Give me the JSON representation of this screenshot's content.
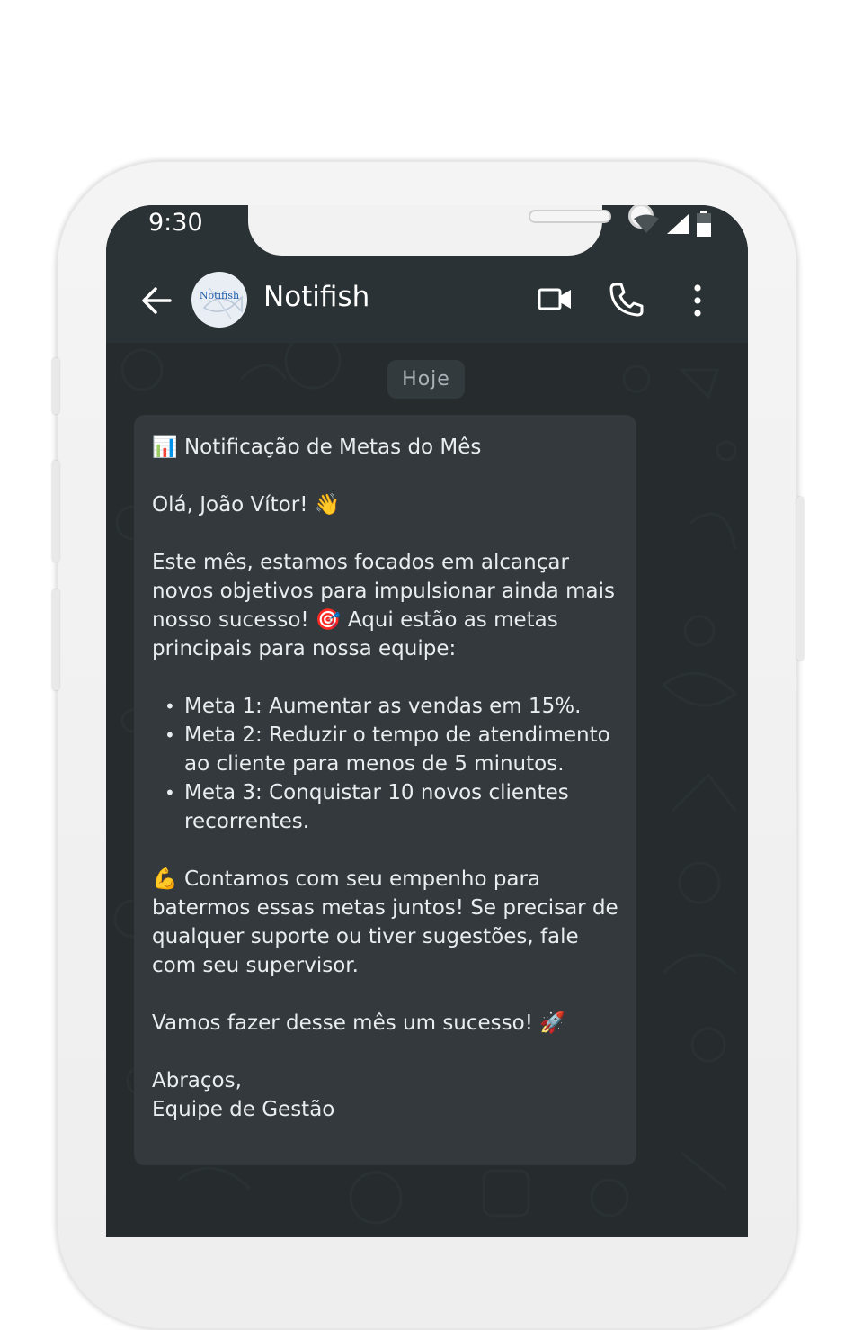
{
  "status_bar": {
    "time": "9:30"
  },
  "header": {
    "contact_name": "Notifish",
    "avatar_text": "Notifish"
  },
  "chat": {
    "date_chip": "Hoje",
    "message": {
      "title": "📊 Notificação de Metas do Mês",
      "greeting": "Olá, João Vítor! 👋",
      "intro": "Este mês, estamos focados em alcançar novos objetivos para impulsionar ainda mais nosso sucesso! 🎯 Aqui estão as metas principais para nossa equipe:",
      "goals": [
        "Meta 1: Aumentar as vendas em 15%.",
        "Meta 2: Reduzir o tempo de atendimento ao cliente para menos de 5 minutos.",
        "Meta 3: Conquistar 10 novos clientes recorrentes."
      ],
      "encouragement": "💪 Contamos com seu empenho para batermos essas metas juntos! Se precisar de qualquer suporte ou tiver sugestões, fale com seu supervisor.",
      "closing": "Vamos fazer desse mês um sucesso! 🚀",
      "sign_off": "Abraços,",
      "signature": "Equipe de Gestão"
    }
  },
  "colors": {
    "header_bg": "#2a3235",
    "chat_bg": "#262c2e",
    "bubble_bg": "#33393c",
    "text": "#e9edef"
  },
  "icons": [
    "back-arrow-icon",
    "video-call-icon",
    "phone-call-icon",
    "more-options-icon",
    "wifi-icon",
    "signal-icon",
    "battery-icon"
  ]
}
